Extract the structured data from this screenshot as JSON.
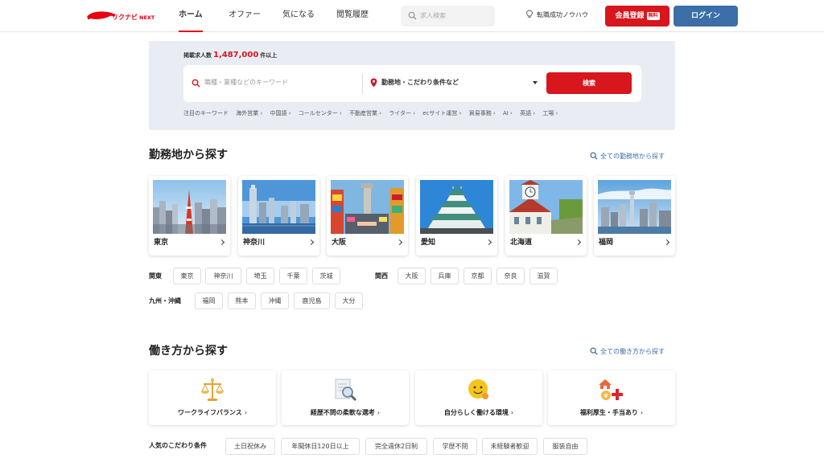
{
  "header": {
    "logo_text": "リクナビNEXT",
    "nav": [
      "ホーム",
      "オファー",
      "気になる",
      "閲覧履歴"
    ],
    "search_placeholder": "求人検索",
    "knowhow": "転職成功ノウハウ",
    "register": "会員登録",
    "register_badge": "無料",
    "login": "ログイン"
  },
  "search": {
    "count_prefix": "掲載求人数",
    "count": "1,487,000",
    "count_suffix": "件以上",
    "keyword_placeholder": "職種・業種などのキーワード",
    "location": "勤務地・こだわり条件など",
    "button": "検索",
    "keywords_label": "注目のキーワード",
    "keywords": [
      "海外営業 ›",
      "中国語 ›",
      "コールセンター ›",
      "不動産営業 ›",
      "ライター ›",
      "ecサイト運営 ›",
      "貿易事務 ›",
      "AI ›",
      "英語 ›",
      "工場 ›"
    ]
  },
  "area": {
    "title": "勤務地から探す",
    "link": "全ての勤務地から探す",
    "cards": [
      "東京",
      "神奈川",
      "大阪",
      "愛知",
      "北海道",
      "福岡"
    ],
    "kanto_label": "関東",
    "kanto": [
      "東京",
      "神奈川",
      "埼玉",
      "千葉",
      "茨城"
    ],
    "kansai_label": "関西",
    "kansai": [
      "大阪",
      "兵庫",
      "京都",
      "奈良",
      "滋賀"
    ],
    "kyushu_label": "九州・沖縄",
    "kyushu": [
      "福岡",
      "熊本",
      "沖縄",
      "鹿児島",
      "大分"
    ]
  },
  "work": {
    "title": "働き方から探す",
    "link": "全ての働き方から探す",
    "cards": [
      "ワークライフバランス",
      "経歴不問の柔軟な選考",
      "自分らしく働ける環境",
      "福利厚生・手当あり"
    ],
    "arrow": "›",
    "popular_label": "人気のこだわり条件",
    "popular": [
      "土日祝休み",
      "年間休日120日以上",
      "完全週休2日制",
      "学歴不問",
      "未経験者歓迎",
      "服装自由"
    ]
  },
  "colors": {
    "brand_red": "#d7161e",
    "login_blue": "#3c6ea8",
    "panel_bg": "#e9edf3"
  }
}
